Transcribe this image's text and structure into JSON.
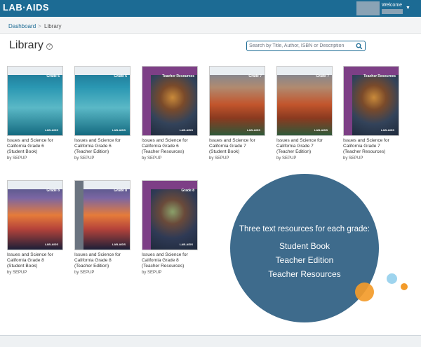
{
  "header": {
    "logo": "LAB·AIDS",
    "welcome": "Welcome"
  },
  "breadcrumb": {
    "home": "Dashboard",
    "separator": ">",
    "current": "Library"
  },
  "page": {
    "title": "Library",
    "help_icon": "question-circle-icon"
  },
  "search": {
    "placeholder": "Search by Title, Author, ISBN or Description",
    "value": ""
  },
  "books": [
    {
      "title_lines": [
        "Issues and Science for",
        "California Grade 6",
        "(Student Book)"
      ],
      "author": "by SEPUP",
      "cover_label": "Grade 6",
      "cover_band": "Teacher",
      "publisher_mark": "LAB-AIDS"
    },
    {
      "title_lines": [
        "Issues and Science for",
        "California Grade 6",
        "(Teacher Edition)"
      ],
      "author": "by SEPUP",
      "cover_label": "Grade 6",
      "cover_band": "Teacher",
      "publisher_mark": "LAB-AIDS"
    },
    {
      "title_lines": [
        "Issues and Science for",
        "California Grade 6",
        "(Teacher Resources)"
      ],
      "author": "by SEPUP",
      "cover_label": "Teacher Resources",
      "cover_band": "",
      "publisher_mark": "LAB-AIDS"
    },
    {
      "title_lines": [
        "Issues and Science for",
        "California Grade 7",
        "(Student Book)"
      ],
      "author": "by SEPUP",
      "cover_label": "Grade 7",
      "cover_band": "",
      "publisher_mark": "LAB-AIDS"
    },
    {
      "title_lines": [
        "Issues and Science for",
        "California Grade 7",
        "(Teacher Edition)"
      ],
      "author": "by SEPUP",
      "cover_label": "Grade 7",
      "cover_band": "",
      "publisher_mark": "LAB-AIDS"
    },
    {
      "title_lines": [
        "Issues and Science for",
        "California Grade 7",
        "(Teacher Resources)"
      ],
      "author": "by SEPUP",
      "cover_label": "Teacher Resources",
      "cover_band": "",
      "publisher_mark": "LAB-AIDS"
    },
    {
      "title_lines": [
        "Issues and Science for",
        "California Grade 8",
        "(Student Book)"
      ],
      "author": "by SEPUP",
      "cover_label": "Grade 8",
      "cover_band": "",
      "publisher_mark": "LAB-AIDS"
    },
    {
      "title_lines": [
        "Issues and Science for",
        "California Grade 8",
        "(Teacher Edition)"
      ],
      "author": "by SEPUP",
      "cover_label": "Grade 8",
      "cover_band": "",
      "publisher_mark": "LAB-AIDS"
    },
    {
      "title_lines": [
        "Issues and Science for",
        "California Grade 8",
        "(Teacher Resources)"
      ],
      "author": "by SEPUP",
      "cover_label": "Grade 8",
      "cover_band": "",
      "publisher_mark": "LAB-AIDS"
    }
  ],
  "callout": {
    "heading": "Three text resources for each grade:",
    "items": [
      "Student Book",
      "Teacher Edition",
      "Teacher Resources"
    ]
  },
  "colors": {
    "brand": "#1c6b94",
    "callout": "#3e6b8c",
    "accent_orange": "#f39b2a",
    "accent_light_blue": "#9ed4ee",
    "teacher_resources_purple": "#7d3f86"
  }
}
